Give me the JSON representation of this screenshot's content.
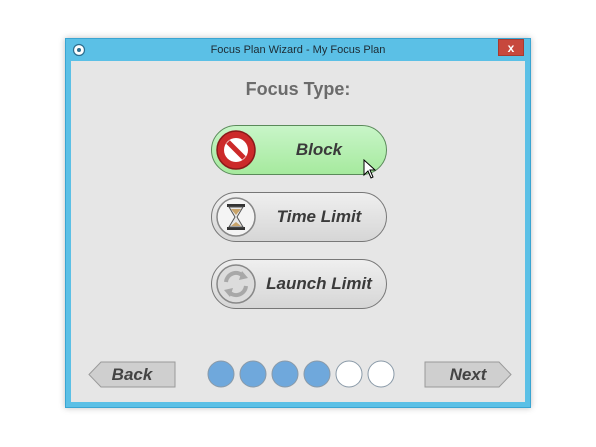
{
  "window": {
    "title": "Focus Plan Wizard - My Focus Plan",
    "close_glyph": "x"
  },
  "heading": "Focus Type:",
  "options": [
    {
      "label": "Block",
      "icon": "block-icon",
      "selected": true
    },
    {
      "label": "Time Limit",
      "icon": "hourglass-icon",
      "selected": false
    },
    {
      "label": "Launch Limit",
      "icon": "refresh-icon",
      "selected": false
    }
  ],
  "nav": {
    "back_label": "Back",
    "next_label": "Next"
  },
  "progress": {
    "total_steps": 6,
    "completed_steps": 4
  },
  "colors": {
    "titlebar": "#5bc0e6",
    "selected_option": "#b3efad",
    "progress_fill": "#6fa8dc",
    "close_button": "#c7483d"
  }
}
